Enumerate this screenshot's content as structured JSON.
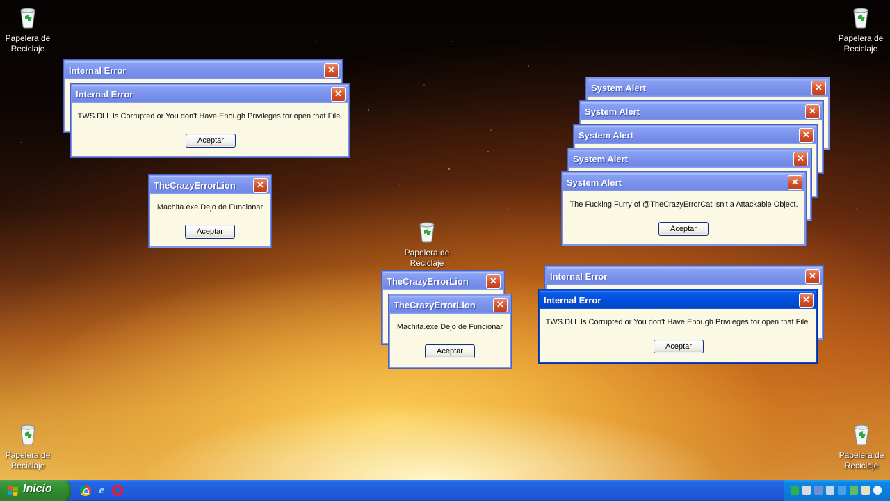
{
  "desktop": {
    "icons": [
      {
        "label": "Papelera de Reciclaje"
      },
      {
        "label": "Papelera de Reciclaje"
      },
      {
        "label": "Papelera de Reciclaje"
      },
      {
        "label": "Papelera de Reciclaje"
      },
      {
        "label": "Papelera de Reciclaje"
      }
    ]
  },
  "windows": [
    {
      "title": "Internal Error",
      "message": "",
      "button": ""
    },
    {
      "title": "Internal Error",
      "message": "TWS.DLL Is Corrupted or You don't Have Enough Privileges for open that File.",
      "button": "Aceptar"
    },
    {
      "title": "TheCrazyErrorLion",
      "message": "Machita.exe Dejo de Funcionar",
      "button": "Aceptar"
    },
    {
      "title": "System Alert",
      "message": "",
      "button": ""
    },
    {
      "title": "System Alert",
      "message": "",
      "button": ""
    },
    {
      "title": "System Alert",
      "message": "",
      "button": ""
    },
    {
      "title": "System Alert",
      "message": "",
      "button": ""
    },
    {
      "title": "System Alert",
      "message": "The Fucking Furry of @TheCrazyErrorCat isn't a Attackable Object.",
      "button": "Aceptar"
    },
    {
      "title": "TheCrazyErrorLion",
      "message": "",
      "button": ""
    },
    {
      "title": "TheCrazyErrorLion",
      "message": "Machita.exe Dejo de Funcionar",
      "button": "Aceptar"
    },
    {
      "title": "Internal Error",
      "message": "",
      "button": ""
    },
    {
      "title": "Internal Error",
      "message": "TWS.DLL Is Corrupted or You don't Have Enough Privileges for open that File.",
      "button": "Aceptar"
    }
  ],
  "close_glyph": "✕",
  "taskbar": {
    "start_label": "Inicio",
    "quick_launch": [
      "chrome-icon",
      "internet-explorer-icon",
      "opera-icon"
    ],
    "colors": {
      "taskbar": "#225ddc",
      "start": "#2f8c30",
      "tray": "#0b7fe0"
    }
  }
}
